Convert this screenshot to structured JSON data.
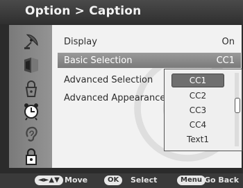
{
  "header": {
    "title": "Option > Caption"
  },
  "sidebar": {
    "items": [
      {
        "icon": "satellite-dish-icon"
      },
      {
        "icon": "display-panels-icon"
      },
      {
        "icon": "lock-padlock-icon"
      },
      {
        "icon": "alarm-clock-icon"
      },
      {
        "icon": "ear-icon"
      },
      {
        "icon": "padlock-icon"
      }
    ]
  },
  "menu": {
    "rows": [
      {
        "label": "Display",
        "value": "On"
      },
      {
        "label": "Basic Selection",
        "value": "CC1"
      },
      {
        "label": "Advanced Selection",
        "value": ""
      },
      {
        "label": "Advanced Appearance",
        "value": ""
      }
    ]
  },
  "dropdown": {
    "options": [
      "CC1",
      "CC2",
      "CC3",
      "CC4",
      "Text1"
    ],
    "selected": "CC1"
  },
  "footer": {
    "nav_key": "◄►▲▼",
    "nav_hint": "Move",
    "ok_key": "OK",
    "ok_hint": "Select",
    "menu_key": "Menu",
    "menu_hint": "Go Back"
  },
  "colors": {
    "panel": "#f2f2f2",
    "highlight": "#8a8a8a",
    "sidebar": "#8a8a8a",
    "footer": "#3a3a3a"
  }
}
